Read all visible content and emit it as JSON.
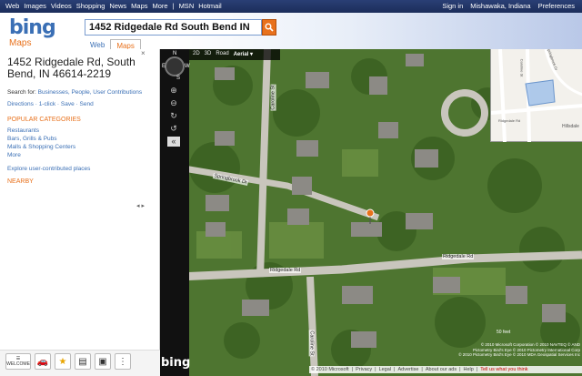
{
  "topbar": {
    "links": [
      "Web",
      "Images",
      "Videos",
      "Shopping",
      "News",
      "Maps",
      "More",
      "|",
      "MSN",
      "Hotmail"
    ],
    "sign_in": "Sign in",
    "location": "Mishawaka, Indiana",
    "preferences": "Preferences"
  },
  "header": {
    "logo": "bing",
    "logo_sub": "Maps",
    "search_value": "1452 Ridgedale Rd South Bend IN",
    "tabs": [
      "Web",
      "Maps"
    ]
  },
  "sidebar": {
    "close": "×",
    "address": "1452 Ridgedale Rd, South Bend, IN 46614-2219",
    "search_for_label": "Search for: ",
    "search_for_link": "Businesses, People, User Contributions",
    "actions": [
      "Directions",
      "1-click",
      "Save",
      "Send"
    ],
    "popular_title": "POPULAR CATEGORIES",
    "categories": [
      "Restaurants",
      "Bars, Grills & Pubs",
      "Malls & Shopping Centers",
      "More"
    ],
    "explore": "Explore user-contributed places",
    "nearby": "NEARBY",
    "arrows": "◂ ▸",
    "tools": [
      "WELCOME",
      "car",
      "star",
      "print",
      "bus",
      "traffic"
    ]
  },
  "map": {
    "toolbar": [
      "2D",
      "3D",
      "Road",
      "Aerial ▾"
    ],
    "compass": [
      "N",
      "E",
      "S",
      "W"
    ],
    "zoom_labels": [
      "⊕",
      "⊖",
      "↻",
      "↺",
      "«"
    ],
    "roads": [
      "Springbrook Dr",
      "Ridgedale Rd",
      "Ridgedale Rd",
      "Caroline St",
      "Caroline St"
    ],
    "minimap_labels": [
      "Springbrook Dr",
      "Caroline St",
      "Ridgedale Rd",
      "Hillsdale"
    ],
    "scale": "50 feet",
    "copyright": [
      "© 2010 Microsoft Corporation  © 2010 NAVTEQ  © AND",
      "Pictometry Bird's Eye © 2010 Pictometry International Corp",
      "© 2010 Pictometry Bird's Eye © 2010 MDA Geospatial Services Inc"
    ],
    "watermark": "bing"
  },
  "footer": {
    "items": [
      "© 2010 Microsoft",
      "|",
      "Privacy",
      "|",
      "Legal",
      "|",
      "Advertise",
      "|",
      "About our ads",
      "|",
      "Help",
      "|"
    ],
    "feedback": "Tell us what you think"
  }
}
